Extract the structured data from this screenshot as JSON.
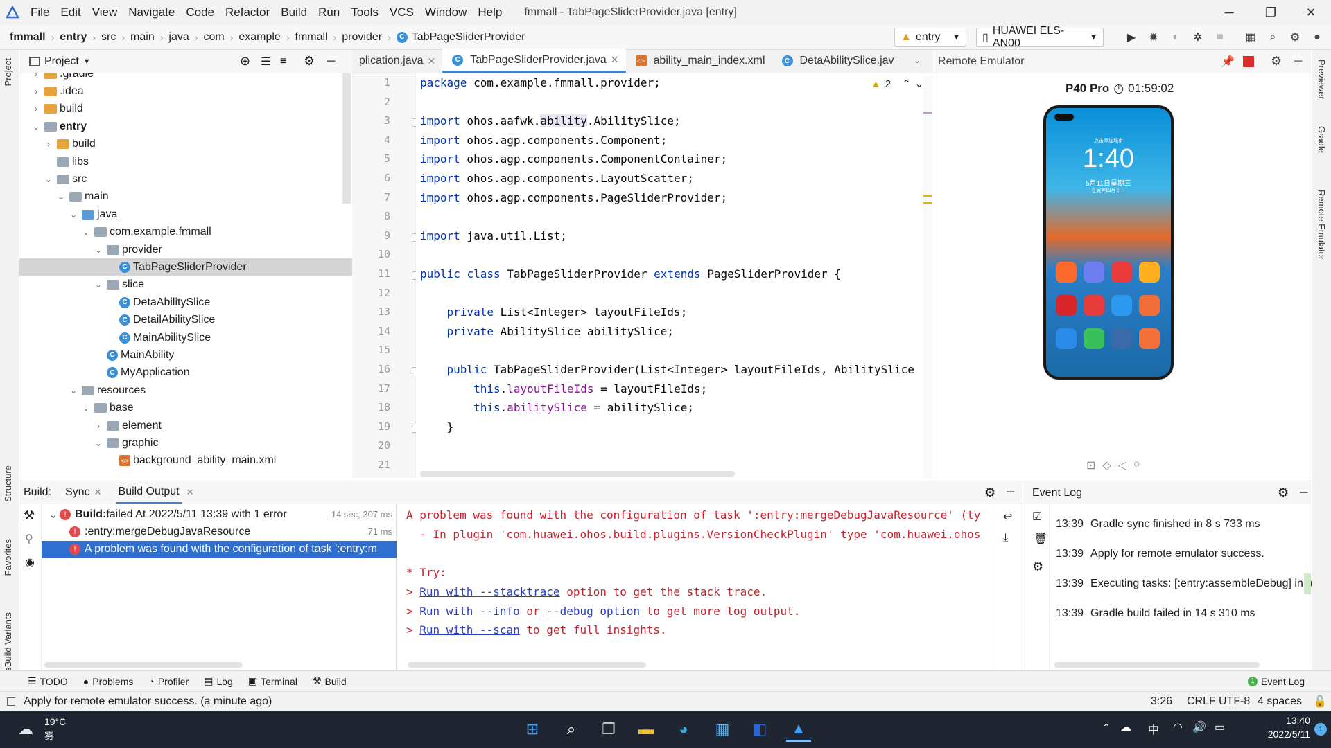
{
  "app": {
    "title": "fmmall - TabPageSliderProvider.java [entry]",
    "menu": [
      "File",
      "Edit",
      "View",
      "Navigate",
      "Code",
      "Refactor",
      "Build",
      "Run",
      "Tools",
      "VCS",
      "Window",
      "Help"
    ]
  },
  "breadcrumb": [
    "fmmall",
    "entry",
    "src",
    "main",
    "java",
    "com",
    "example",
    "fmmall",
    "provider",
    "TabPageSliderProvider"
  ],
  "run_config": "entry",
  "device": "HUAWEI ELS-AN00",
  "left_strip": [
    "Project",
    "Structure",
    "Favorites",
    "OhosBuild Variants"
  ],
  "right_strip": [
    "Previewer",
    "Gradle",
    "Remote Emulator"
  ],
  "project_panel": {
    "title": "Project",
    "tree": [
      {
        "label": ".gradle",
        "level": 1,
        "kind": "folder-orange",
        "arrow": "›"
      },
      {
        "label": ".idea",
        "level": 1,
        "kind": "folder-orange",
        "arrow": "›"
      },
      {
        "label": "build",
        "level": 1,
        "kind": "folder-orange",
        "arrow": "›"
      },
      {
        "label": "entry",
        "level": 1,
        "kind": "folder-grey",
        "arrow": "⌄",
        "bold": true
      },
      {
        "label": "build",
        "level": 2,
        "kind": "folder-orange",
        "arrow": "›"
      },
      {
        "label": "libs",
        "level": 2,
        "kind": "folder-grey",
        "arrow": ""
      },
      {
        "label": "src",
        "level": 2,
        "kind": "folder-grey",
        "arrow": "⌄"
      },
      {
        "label": "main",
        "level": 3,
        "kind": "folder-grey",
        "arrow": "⌄"
      },
      {
        "label": "java",
        "level": 4,
        "kind": "folder-blue",
        "arrow": "⌄"
      },
      {
        "label": "com.example.fmmall",
        "level": 5,
        "kind": "folder-grey",
        "arrow": "⌄"
      },
      {
        "label": "provider",
        "level": 6,
        "kind": "folder-grey",
        "arrow": "⌄"
      },
      {
        "label": "TabPageSliderProvider",
        "level": 7,
        "kind": "class",
        "arrow": "",
        "selected": true
      },
      {
        "label": "slice",
        "level": 6,
        "kind": "folder-grey",
        "arrow": "⌄"
      },
      {
        "label": "DetaAbilitySlice",
        "level": 7,
        "kind": "class",
        "arrow": ""
      },
      {
        "label": "DetailAbilitySlice",
        "level": 7,
        "kind": "class",
        "arrow": ""
      },
      {
        "label": "MainAbilitySlice",
        "level": 7,
        "kind": "class",
        "arrow": ""
      },
      {
        "label": "MainAbility",
        "level": 6,
        "kind": "class",
        "arrow": ""
      },
      {
        "label": "MyApplication",
        "level": 6,
        "kind": "class",
        "arrow": ""
      },
      {
        "label": "resources",
        "level": 4,
        "kind": "folder-grey",
        "arrow": "⌄"
      },
      {
        "label": "base",
        "level": 5,
        "kind": "folder-grey",
        "arrow": "⌄"
      },
      {
        "label": "element",
        "level": 6,
        "kind": "folder-grey",
        "arrow": "›"
      },
      {
        "label": "graphic",
        "level": 6,
        "kind": "folder-grey",
        "arrow": "⌄"
      },
      {
        "label": "background_ability_main.xml",
        "level": 7,
        "kind": "xml",
        "arrow": ""
      }
    ]
  },
  "editor": {
    "tabs": [
      {
        "label": "plication.java",
        "active": false
      },
      {
        "label": "TabPageSliderProvider.java",
        "active": true
      },
      {
        "label": "ability_main_index.xml",
        "active": false
      },
      {
        "label": "DetaAbilitySlice.jav",
        "active": false
      }
    ],
    "warnings": "2",
    "lines": [
      {
        "n": "1",
        "text": "package com.example.fmmall.provider;"
      },
      {
        "n": "2",
        "text": ""
      },
      {
        "n": "3",
        "text": "import ohos.aafwk.ability.AbilitySlice;"
      },
      {
        "n": "4",
        "text": "import ohos.agp.components.Component;"
      },
      {
        "n": "5",
        "text": "import ohos.agp.components.ComponentContainer;"
      },
      {
        "n": "6",
        "text": "import ohos.agp.components.LayoutScatter;"
      },
      {
        "n": "7",
        "text": "import ohos.agp.components.PageSliderProvider;"
      },
      {
        "n": "8",
        "text": ""
      },
      {
        "n": "9",
        "text": "import java.util.List;"
      },
      {
        "n": "10",
        "text": ""
      },
      {
        "n": "11",
        "text": "public class TabPageSliderProvider extends PageSliderProvider {"
      },
      {
        "n": "12",
        "text": ""
      },
      {
        "n": "13",
        "text": "    private List<Integer> layoutFileIds;"
      },
      {
        "n": "14",
        "text": "    private AbilitySlice abilitySlice;"
      },
      {
        "n": "15",
        "text": ""
      },
      {
        "n": "16",
        "text": "    public TabPageSliderProvider(List<Integer> layoutFileIds, AbilitySlice"
      },
      {
        "n": "17",
        "text": "        this.layoutFileIds = layoutFileIds;"
      },
      {
        "n": "18",
        "text": "        this.abilitySlice = abilitySlice;"
      },
      {
        "n": "19",
        "text": "    }"
      },
      {
        "n": "20",
        "text": ""
      },
      {
        "n": "21",
        "text": ""
      }
    ]
  },
  "emulator": {
    "panel_title": "Remote Emulator",
    "device": "P40 Pro",
    "timer": "01:59:02",
    "clock": "1:40",
    "date": "5月11日星期三",
    "carrier": "点击添加城市",
    "lunar": "壬寅年四月十一"
  },
  "build": {
    "label": "Build:",
    "tabs": [
      "Sync",
      "Build Output"
    ],
    "tree": [
      {
        "bold": "Build:",
        "text": " failed At 2022/5/11 13:39 with 1 error",
        "time": "14 sec, 307 ms"
      },
      {
        "text": ":entry:mergeDebugJavaResource",
        "time": "71 ms"
      },
      {
        "text": "A problem was found with the configuration of task ':entry:m",
        "time": ""
      }
    ],
    "output": [
      {
        "parts": [
          {
            "t": "A problem was found with the configuration of task ':entry:mergeDebugJavaResource' (ty",
            "c": "red"
          }
        ]
      },
      {
        "parts": [
          {
            "t": "  - In plugin 'com.huawei.ohos.build.plugins.VersionCheckPlugin' type 'com.huawei.ohos",
            "c": "red"
          }
        ]
      },
      {
        "parts": [
          {
            "t": "",
            "c": ""
          }
        ]
      },
      {
        "parts": [
          {
            "t": "* Try:",
            "c": "red"
          }
        ]
      },
      {
        "parts": [
          {
            "t": "> ",
            "c": "red"
          },
          {
            "t": "Run with --stacktrace",
            "c": "lnk"
          },
          {
            "t": " option to get the stack trace.",
            "c": "red"
          }
        ]
      },
      {
        "parts": [
          {
            "t": "> ",
            "c": "red"
          },
          {
            "t": "Run with --info",
            "c": "lnk"
          },
          {
            "t": " or ",
            "c": "red"
          },
          {
            "t": "--debug option",
            "c": "lnk"
          },
          {
            "t": " to get more log output.",
            "c": "red"
          }
        ]
      },
      {
        "parts": [
          {
            "t": "> ",
            "c": "red"
          },
          {
            "t": "Run with --scan",
            "c": "lnk"
          },
          {
            "t": " to get full insights.",
            "c": "red"
          }
        ]
      }
    ]
  },
  "event_log": {
    "title": "Event Log",
    "entries": [
      {
        "time": "13:39",
        "text": "Gradle sync finished in 8 s 733 ms"
      },
      {
        "time": "13:39",
        "text": "Apply for remote emulator success."
      },
      {
        "time": "13:39",
        "text": "Executing tasks: [:entry:assembleDebug] in p"
      },
      {
        "time": "13:39",
        "text": "Gradle build failed in 14 s 310 ms"
      }
    ]
  },
  "tool_windows": [
    "TODO",
    "Problems",
    "Profiler",
    "Log",
    "Terminal",
    "Build"
  ],
  "event_log_button": "Event Log",
  "status": {
    "message": "Apply for remote emulator success. (a minute ago)",
    "position": "3:26",
    "line_sep": "CRLF",
    "encoding": "UTF-8",
    "indent": "4 spaces"
  },
  "taskbar": {
    "temp": "19°C",
    "weather": "雾",
    "ime": "中",
    "time": "13:40",
    "date": "2022/5/11",
    "notif": "1"
  }
}
